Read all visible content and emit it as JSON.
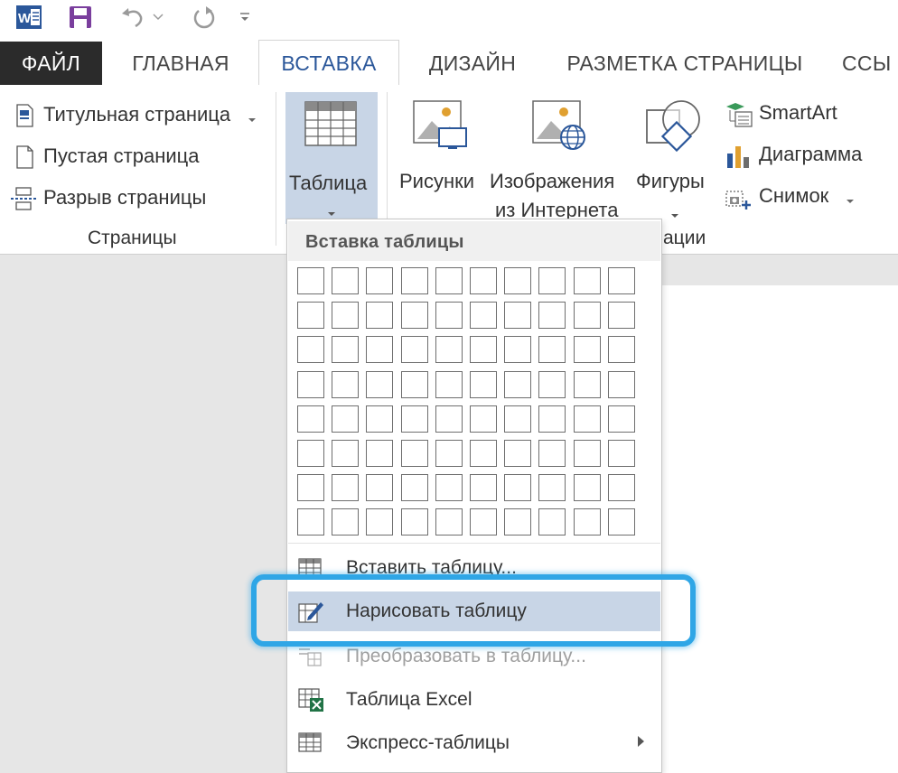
{
  "tabs": {
    "file": "ФАЙЛ",
    "home": "ГЛАВНАЯ",
    "insert": "ВСТАВКА",
    "design": "ДИЗАЙН",
    "layout": "РАЗМЕТКА СТРАНИЦЫ",
    "references": "ССЫ"
  },
  "ribbon": {
    "pages": {
      "cover_page": "Титульная страница",
      "blank_page": "Пустая страница",
      "page_break": "Разрыв страницы",
      "group_label": "Страницы"
    },
    "tables": {
      "table_label": "Таблица"
    },
    "illustrations": {
      "pictures": "Рисунки",
      "online_pictures_line1": "Изображения",
      "online_pictures_line2": "из Интернета",
      "shapes": "Фигуры",
      "smartart": "SmartArt",
      "chart": "Диаграмма",
      "screenshot": "Снимок",
      "group_label_partial": "ации"
    }
  },
  "dropdown": {
    "title": "Вставка таблицы",
    "grid": {
      "columns": 10,
      "rows": 8
    },
    "items": [
      {
        "label": "Вставить таблицу...",
        "state": "partially-hidden"
      },
      {
        "label": "Нарисовать таблицу",
        "state": "highlighted"
      },
      {
        "label": "Преобразовать в таблицу...",
        "state": "disabled"
      },
      {
        "label": "Таблица Excel",
        "state": "normal"
      },
      {
        "label": "Экспресс-таблицы",
        "state": "submenu"
      }
    ]
  },
  "colors": {
    "accent": "#2b579a",
    "file_tab_bg": "#2b2b2b",
    "callout": "#2fa6e6",
    "table_button_bg": "#c8d5e6",
    "save_icon": "#7a3e9d"
  }
}
